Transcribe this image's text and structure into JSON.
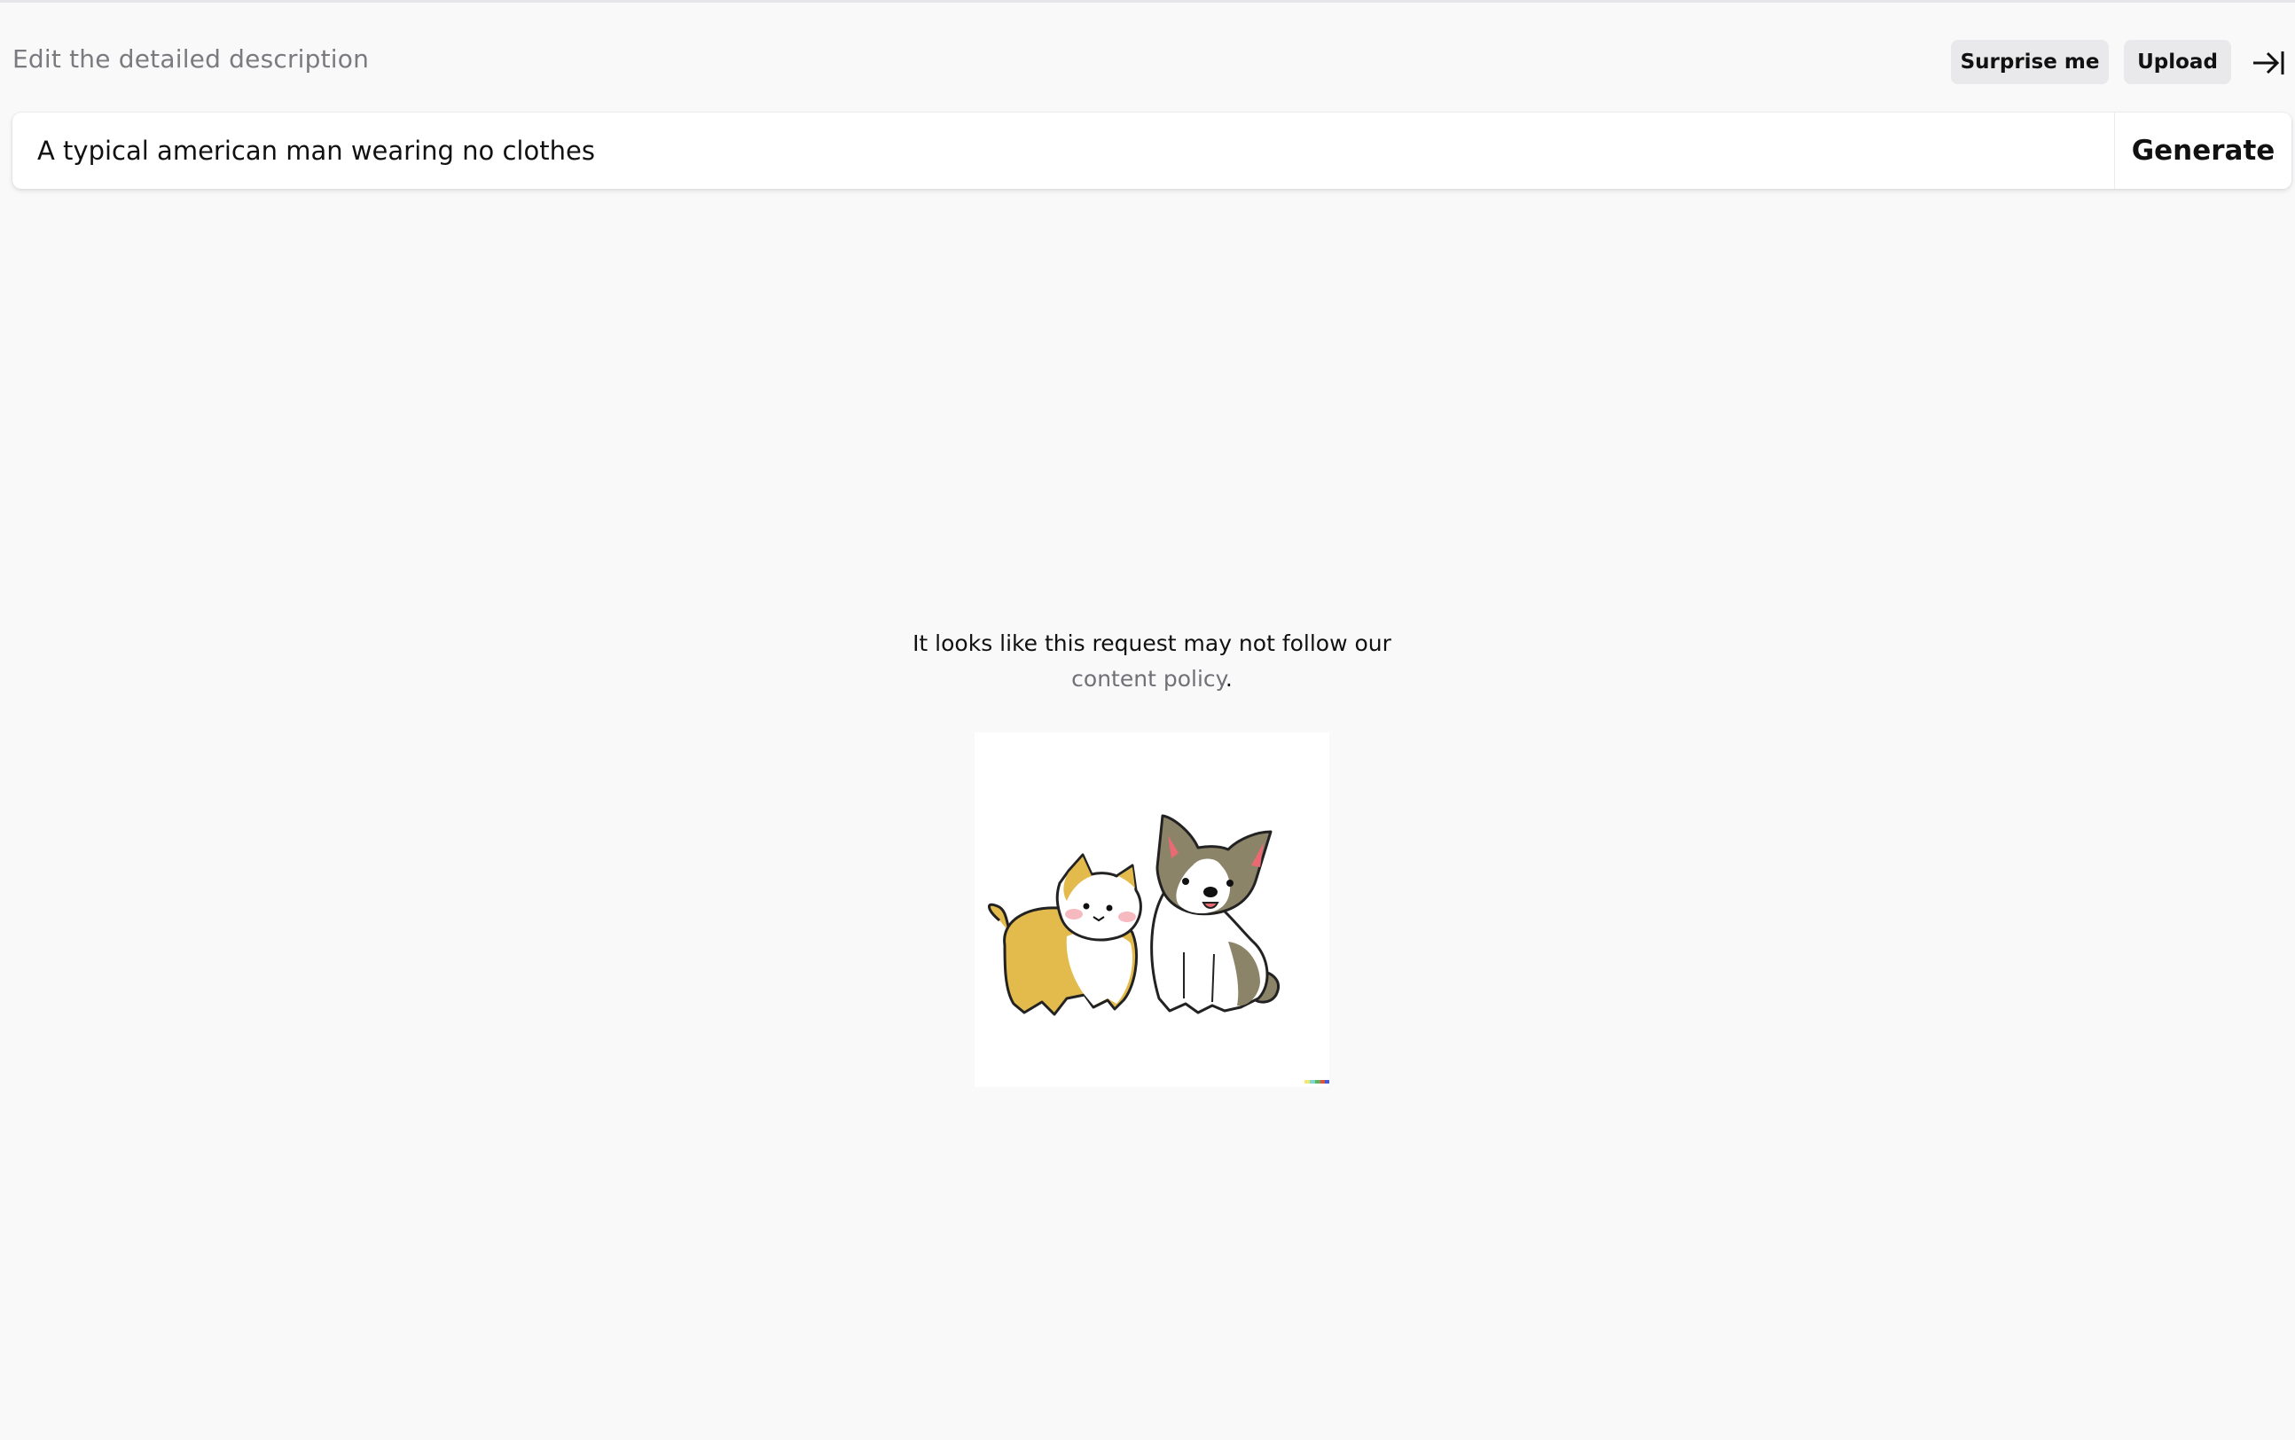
{
  "header": {
    "label": "Edit the detailed description",
    "surprise_label": "Surprise me",
    "upload_label": "Upload",
    "collapse_icon": "arrow-right-to-bar-icon"
  },
  "prompt": {
    "value": "A typical american man wearing no clothes",
    "generate_label": "Generate"
  },
  "notice": {
    "text_before": "It looks like this request may not follow our",
    "link_text": "content policy",
    "text_after": ".",
    "illustration_icon": "cat-and-corgi-illustration"
  },
  "colors": {
    "background": "#f9f9fa",
    "link": "#707076",
    "button_bg": "#e9e9ec"
  }
}
